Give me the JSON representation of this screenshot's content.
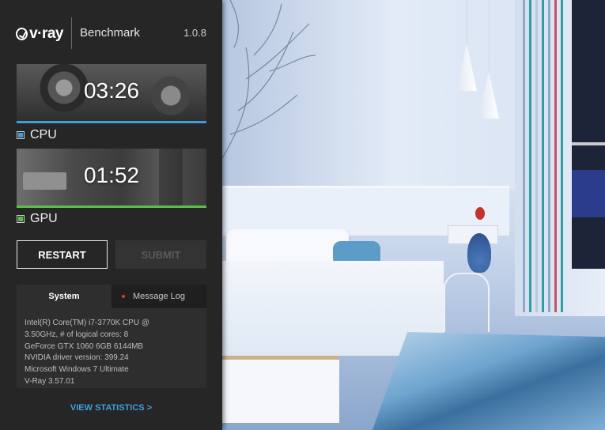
{
  "header": {
    "logo_text": "v·ray",
    "title": "Benchmark",
    "version": "1.0.8"
  },
  "cpu": {
    "time": "03:26",
    "label": "CPU",
    "color": "#3d9fd8"
  },
  "gpu": {
    "time": "01:52",
    "label": "GPU",
    "color": "#5cbd4b"
  },
  "buttons": {
    "restart": "RESTART",
    "submit": "SUBMIT"
  },
  "tabs": {
    "system": "System",
    "message_log": "Message Log"
  },
  "system_info": [
    "Intel(R) Core(TM) i7-3770K CPU @",
    "3.50GHz, # of logical cores: 8",
    "GeForce GTX 1060 6GB 6144MB",
    "NVIDIA driver version: 399.24",
    "Microsoft Windows 7 Ultimate",
    "V-Ray 3.57.01"
  ],
  "footer": {
    "view_statistics": "VIEW STATISTICS >"
  },
  "colors": {
    "accent_blue": "#3ea0dc",
    "panel_bg": "#262626"
  }
}
